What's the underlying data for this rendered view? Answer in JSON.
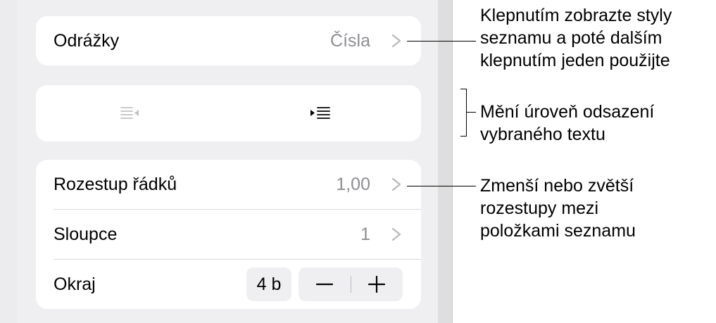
{
  "list_panel": {
    "bullets": {
      "label": "Odrážky",
      "value": "Čísla"
    },
    "indent": {
      "decrease_icon": "outdent-icon",
      "increase_icon": "indent-icon"
    },
    "line_spacing": {
      "label": "Rozestup řádků",
      "value": "1,00"
    },
    "columns": {
      "label": "Sloupce",
      "value": "1"
    },
    "margin": {
      "label": "Okraj",
      "value": "4 b",
      "minus": "−",
      "plus": "+"
    }
  },
  "callouts": {
    "bullets": "Klepnutím zobrazte styly\nseznamu a poté dalším\nklepnutím jeden použijte",
    "indent": "Mění úroveň odsazení\nvybraného textu",
    "spacing": "Zmenší nebo zvětší\nrozestupy mezi\npoložkami seznamu"
  },
  "colors": {
    "panel_bg": "#efeff2",
    "card_bg": "#ffffff",
    "secondary_text": "#8e8e93",
    "disabled_icon": "#b3b3b8"
  }
}
